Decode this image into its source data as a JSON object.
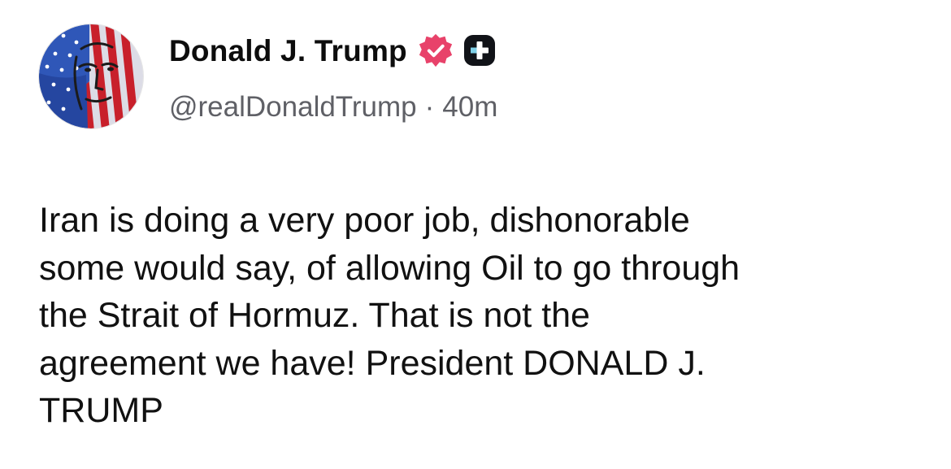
{
  "post": {
    "author": {
      "display_name": "Donald J. Trump",
      "handle": "@realDonaldTrump",
      "verified": true,
      "verified_color": "#e8426a"
    },
    "time_ago": "40m",
    "separator": "·",
    "text": "Iran is doing a very poor job, dishonorable\nsome would say, of allowing Oil to go through\nthe Strait of Hormuz. That is not the\nagreement we have! President DONALD J.\nTRUMP"
  },
  "icons": {
    "avatar": "flag-portrait-avatar",
    "verified": "verified-badge-icon",
    "plus": "plus-badge-icon"
  }
}
